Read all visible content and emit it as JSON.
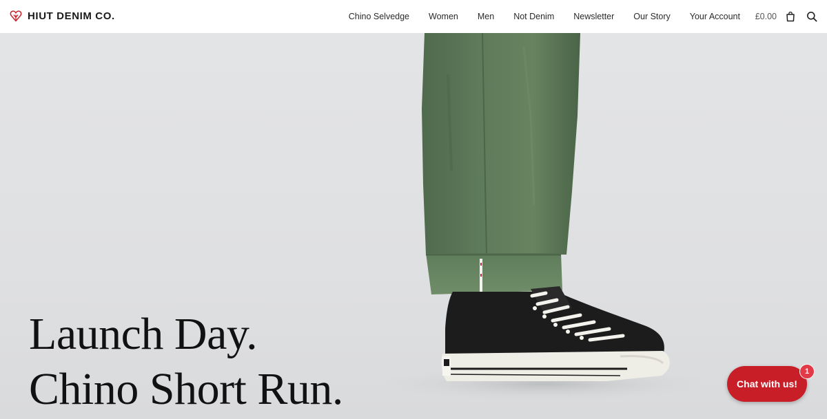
{
  "brand": {
    "name": "HIUT DENIM CO.",
    "logo_icon": "heart-leaf-logo-icon",
    "color": "#c8242d"
  },
  "nav": {
    "items": [
      {
        "label": "Chino Selvedge"
      },
      {
        "label": "Women"
      },
      {
        "label": "Men"
      },
      {
        "label": "Not Denim"
      },
      {
        "label": "Newsletter"
      },
      {
        "label": "Our Story"
      },
      {
        "label": "Your Account"
      }
    ]
  },
  "cart": {
    "total": "£0.00",
    "icon": "shopping-bag-icon"
  },
  "search": {
    "icon": "search-icon"
  },
  "hero": {
    "line1": "Launch Day.",
    "line2": "Chino Short Run."
  },
  "chat": {
    "label": "Chat with us!",
    "badge_count": "1",
    "color": "#c81e28"
  }
}
